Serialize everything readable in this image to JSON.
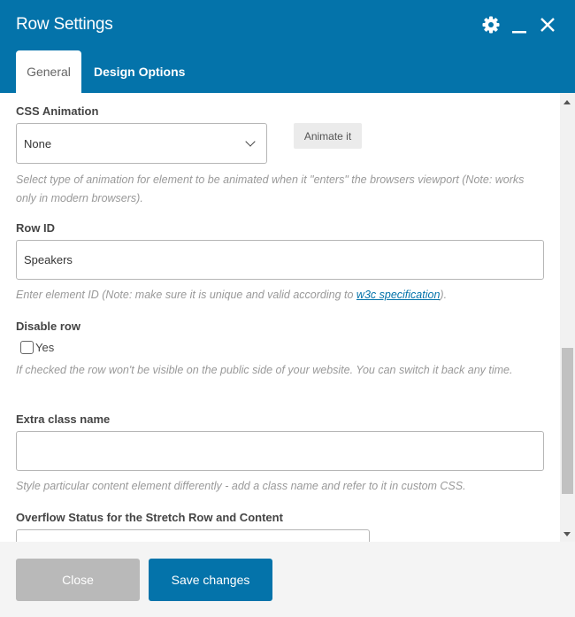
{
  "window": {
    "title": "Row Settings",
    "icons": [
      "gear-icon",
      "minimize-icon",
      "close-icon"
    ]
  },
  "tabs": [
    {
      "label": "General",
      "active": true
    },
    {
      "label": "Design Options",
      "active": false
    }
  ],
  "fields": {
    "css_animation": {
      "label": "CSS Animation",
      "selected": "None",
      "button_label": "Animate it",
      "description": "Select type of animation for element to be animated when it \"enters\" the browsers viewport (Note: works only in modern browsers)."
    },
    "row_id": {
      "label": "Row ID",
      "value": "Speakers",
      "description_prefix": "Enter element ID (Note: make sure it is unique and valid according to ",
      "description_link": "w3c specification",
      "description_suffix": ")."
    },
    "disable_row": {
      "label": "Disable row",
      "checkbox_label": "Yes",
      "checked": false,
      "description": "If checked the row won't be visible on the public side of your website. You can switch it back any time."
    },
    "extra_class": {
      "label": "Extra class name",
      "value": "",
      "description": "Style particular content element differently - add a class name and refer to it in custom CSS."
    },
    "overflow_status": {
      "label": "Overflow Status for the Stretch Row and Content",
      "selected": ""
    }
  },
  "footer": {
    "close_label": "Close",
    "save_label": "Save changes"
  },
  "colors": {
    "brand": "#0473aa",
    "close_button": "#b9b9b9"
  }
}
